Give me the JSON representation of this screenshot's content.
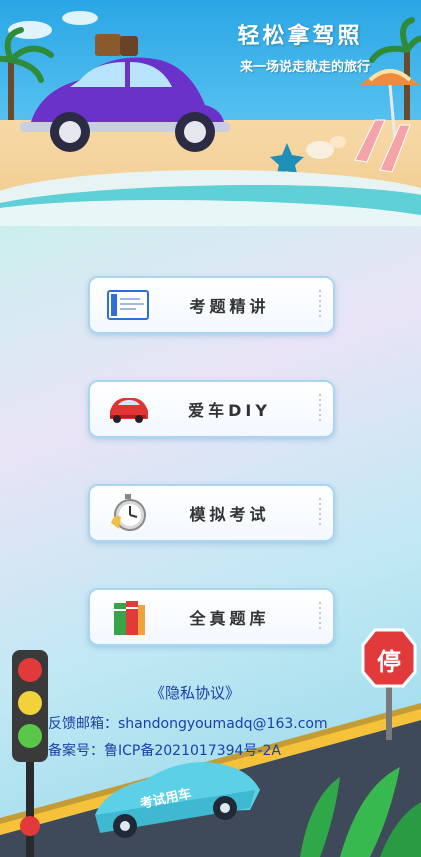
{
  "banner": {
    "title": "轻松拿驾照",
    "subtitle": "来一场说走就走的旅行"
  },
  "menu": [
    {
      "label": "考题精讲",
      "icon": "document-screen-icon"
    },
    {
      "label": "爱车DIY",
      "icon": "red-car-icon"
    },
    {
      "label": "模拟考试",
      "icon": "stopwatch-icon"
    },
    {
      "label": "全真题库",
      "icon": "books-icon"
    }
  ],
  "footer": {
    "privacy": "《隐私协议》",
    "feedback": "反馈邮箱：shandongyoumadq@163.com",
    "record": "备案号：鲁ICP备2021017394号-2A"
  },
  "scene": {
    "stop_sign": "停",
    "car_text": "考试用车"
  }
}
